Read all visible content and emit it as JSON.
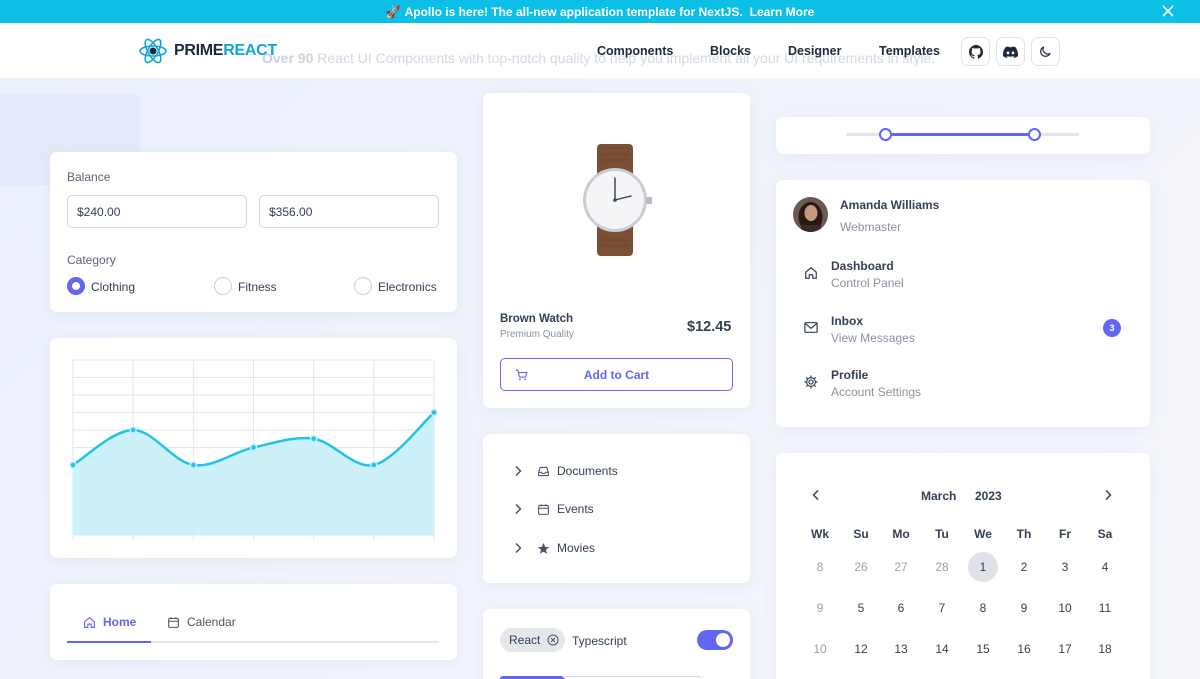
{
  "banner": {
    "rocket": "🚀",
    "text": "Apollo is here! The all-new application template for NextJS.",
    "link": "Learn More"
  },
  "header": {
    "logo_prime": "PRIME",
    "logo_react": "REACT",
    "ghost_bold": "Over 90",
    "ghost_text": "React UI Components with top-notch quality to help you implement all your UI requirements in style.",
    "nav": [
      "Components",
      "Blocks",
      "Designer",
      "Templates"
    ]
  },
  "balance_card": {
    "balance_label": "Balance",
    "value_1": "$240.00",
    "value_2": "$356.00",
    "category_label": "Category",
    "options": [
      "Clothing",
      "Fitness",
      "Electronics"
    ],
    "selected": "Clothing"
  },
  "product": {
    "name": "Brown Watch",
    "subtitle": "Premium Quality",
    "price": "$12.45",
    "button": "Add to Cart"
  },
  "tree": [
    "Documents",
    "Events",
    "Movies"
  ],
  "chips": {
    "chip": "React",
    "text": "Typescript",
    "toggle_on": true
  },
  "slider": {
    "low": 0.17,
    "high": 0.81
  },
  "profile": {
    "name": "Amanda Williams",
    "role": "Webmaster",
    "menu": [
      {
        "title": "Dashboard",
        "subtitle": "Control Panel",
        "icon": "home-icon"
      },
      {
        "title": "Inbox",
        "subtitle": "View Messages",
        "icon": "envelope-icon",
        "badge": "3"
      },
      {
        "title": "Profile",
        "subtitle": "Account Settings",
        "icon": "gear-icon"
      }
    ]
  },
  "calendar": {
    "month": "March",
    "year": "2023",
    "weekdays": [
      "Wk",
      "Su",
      "Mo",
      "Tu",
      "We",
      "Th",
      "Fr",
      "Sa"
    ],
    "rows": [
      [
        "8",
        "26",
        "27",
        "28",
        "1",
        "2",
        "3",
        "4"
      ],
      [
        "9",
        "5",
        "6",
        "7",
        "8",
        "9",
        "10",
        "11"
      ],
      [
        "10",
        "12",
        "13",
        "14",
        "15",
        "16",
        "17",
        "18"
      ]
    ],
    "selected": "1"
  },
  "tabs": [
    "Home",
    "Calendar"
  ],
  "chart_data": {
    "type": "area",
    "x": [
      0,
      1,
      2,
      3,
      4,
      5,
      6
    ],
    "values": [
      4,
      6,
      4,
      5,
      5.5,
      4,
      7
    ],
    "ylim": [
      0,
      10
    ],
    "color": "#22c3e6",
    "fill": "#c4eef8",
    "grid": true
  },
  "colors": {
    "accent": "#6366f1",
    "banner": "#0bbfe6",
    "chart_line": "#22c3e6"
  }
}
